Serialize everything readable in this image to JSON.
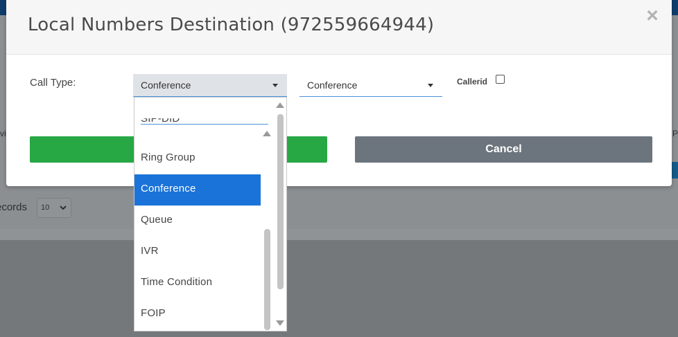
{
  "modal": {
    "title": "Local Numbers Destination (972559664944)",
    "close_symbol": "×",
    "call_type_label": "Call Type:",
    "call_type_value": "Conference",
    "destination_value": "Conference",
    "callerid_label": "Callerid",
    "callerid_checked": false,
    "cancel_label": "Cancel"
  },
  "dropdown": {
    "options": [
      "SIP-DID",
      "Ring Group",
      "Conference",
      "Queue",
      "IVR",
      "Time Condition",
      "FOIP"
    ],
    "selected": "Conference"
  },
  "background": {
    "records_label": "ecords",
    "records_value": "10",
    "edge_left": "vi",
    "edge_right": "P"
  },
  "colors": {
    "save_button": "#28a745",
    "cancel_button": "#6c757d",
    "selected_option": "#1a73d9"
  }
}
